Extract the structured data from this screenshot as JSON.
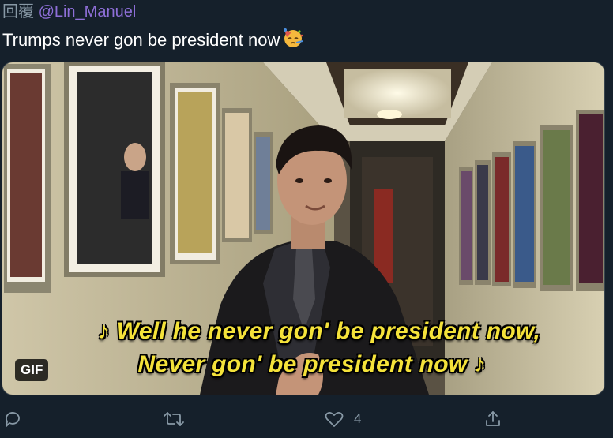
{
  "reply": {
    "prefix": "回覆",
    "handle": "@Lin_Manuel"
  },
  "tweet": {
    "text": "Trumps never gon be president now",
    "emoji": "partying-face-emoji"
  },
  "media": {
    "badge": "GIF",
    "subtitle_line1": "♪ Well he never gon' be president now,",
    "subtitle_line2": "Never gon' be president now ♪"
  },
  "actions": {
    "reply_icon": "reply-icon",
    "retweet_icon": "retweet-icon",
    "like_icon": "heart-icon",
    "like_count": "4",
    "share_icon": "share-icon"
  },
  "colors": {
    "background": "#15202b",
    "handle": "#8e6fd8",
    "muted": "#8899a6",
    "subtitle": "#f4e23a"
  }
}
